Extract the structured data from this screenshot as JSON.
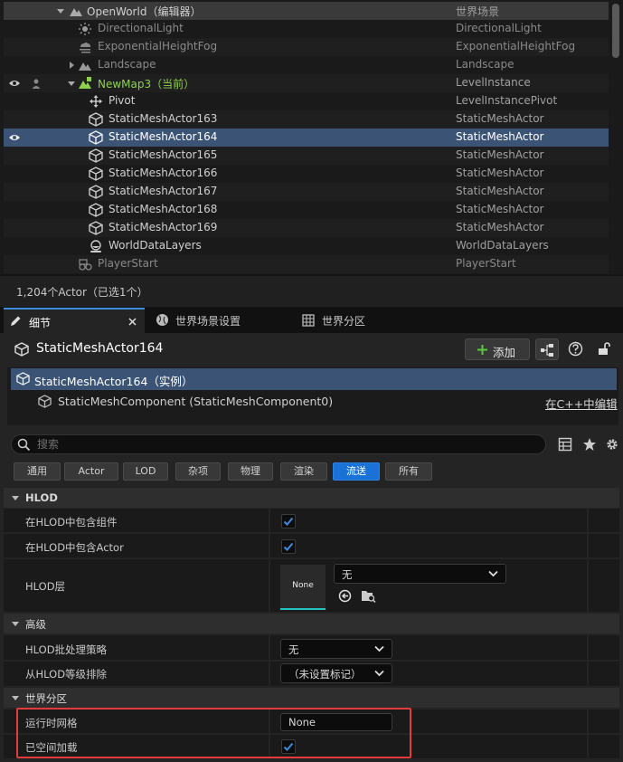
{
  "outliner": {
    "rows": [
      {
        "name": "OpenWorld（编辑器）",
        "type": "世界场景"
      },
      {
        "name": "DirectionalLight",
        "type": "DirectionalLight"
      },
      {
        "name": "ExponentialHeightFog",
        "type": "ExponentialHeightFog"
      },
      {
        "name": "Landscape",
        "type": "Landscape"
      },
      {
        "name": "NewMap3（当前）",
        "type": "LevelInstance"
      },
      {
        "name": "Pivot",
        "type": "LevelInstancePivot"
      },
      {
        "name": "StaticMeshActor163",
        "type": "StaticMeshActor"
      },
      {
        "name": "StaticMeshActor164",
        "type": "StaticMeshActor"
      },
      {
        "name": "StaticMeshActor165",
        "type": "StaticMeshActor"
      },
      {
        "name": "StaticMeshActor166",
        "type": "StaticMeshActor"
      },
      {
        "name": "StaticMeshActor167",
        "type": "StaticMeshActor"
      },
      {
        "name": "StaticMeshActor168",
        "type": "StaticMeshActor"
      },
      {
        "name": "StaticMeshActor169",
        "type": "StaticMeshActor"
      },
      {
        "name": "WorldDataLayers",
        "type": "WorldDataLayers"
      },
      {
        "name": "PlayerStart",
        "type": "PlayerStart"
      }
    ],
    "status": "1,204个Actor（已选1个）"
  },
  "tabs": [
    {
      "label": "细节"
    },
    {
      "label": "世界场景设置"
    },
    {
      "label": "世界分区"
    }
  ],
  "details": {
    "actor_name": "StaticMeshActor164",
    "add_label": "添加",
    "components": {
      "root": "StaticMeshActor164（实例）",
      "child": "StaticMeshComponent (StaticMeshComponent0)",
      "edit_link": "在C++中编辑"
    },
    "search_placeholder": "搜索",
    "filters": [
      "通用",
      "Actor",
      "LOD",
      "杂项",
      "物理",
      "渲染",
      "流送",
      "所有"
    ],
    "sections": {
      "hlod": {
        "title": "HLOD",
        "include_components": "在HLOD中包含组件",
        "include_actor": "在HLOD中包含Actor",
        "hlod_layer": "HLOD层",
        "thumb_label": "None",
        "layer_value": "无"
      },
      "advanced": {
        "title": "高级",
        "batching_policy": "HLOD批处理策略",
        "batching_value": "无",
        "exclude_levels": "从HLOD等级排除",
        "exclude_value": "（未设置标记）"
      },
      "world_partition": {
        "title": "世界分区",
        "runtime_grid": "运行时网格",
        "runtime_grid_value": "None",
        "spatially_loaded": "已空间加载"
      }
    }
  },
  "colors": {
    "accent": "#1a72d6",
    "selection": "#3b5475",
    "highlight": "#e23b3b",
    "current_level": "#8fd14f"
  }
}
